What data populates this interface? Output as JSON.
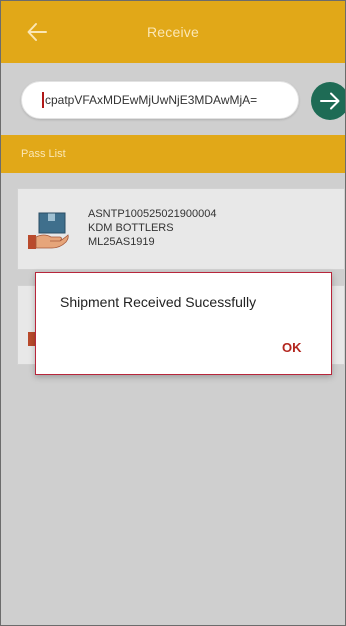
{
  "appbar": {
    "title": "Receive",
    "back_icon": "arrow-left-icon",
    "background": "#e1a818"
  },
  "search": {
    "value": "cpatpVFAxMDEwMjUwNjE3MDAwMjA=",
    "go_icon": "arrow-right-icon",
    "go_color": "#1e6b55"
  },
  "pass_list": {
    "header": "Pass List",
    "items": [
      {
        "pass_number": "ASNTP100525021900004",
        "company": "KDM BOTTLERS",
        "vehicle": "ML25AS1919",
        "icon": "package-hand-icon"
      },
      {
        "icon": "package-hand-icon"
      }
    ]
  },
  "dialog": {
    "message": "Shipment Received Sucessfully",
    "ok_label": "OK",
    "accent": "#b3261e"
  }
}
